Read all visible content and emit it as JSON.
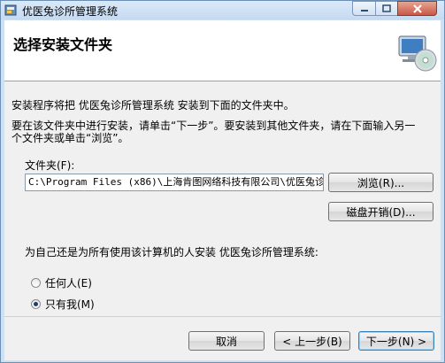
{
  "window": {
    "title": "优医兔诊所管理系统",
    "controls": [
      "minimize-icon",
      "maximize-icon",
      "close-icon"
    ]
  },
  "header": {
    "title": "选择安装文件夹",
    "icon": "computer-cd-icon"
  },
  "body": {
    "intro": "安装程序将把 优医兔诊所管理系统 安装到下面的文件夹中。",
    "instruction_line1": "要在该文件夹中进行安装，请单击“下一步”。要安装到其他文件夹，请在下面输入另一",
    "instruction_line2": "个文件夹或单击“浏览”。",
    "folder_label": "文件夹(F):",
    "folder_value": "C:\\Program Files (x86)\\上海肯图网络科技有限公司\\优医兔诊",
    "browse_button": "浏览(R)...",
    "disk_cost_button": "磁盘开销(D)...",
    "install_for_question": "为自己还是为所有使用该计算机的人安装 优医兔诊所管理系统:",
    "options": [
      {
        "label": "任何人(E)",
        "checked": false
      },
      {
        "label": "只有我(M)",
        "checked": true
      }
    ]
  },
  "footer": {
    "cancel": "取消",
    "back": "< 上一步(B)",
    "next": "下一步(N) >"
  }
}
